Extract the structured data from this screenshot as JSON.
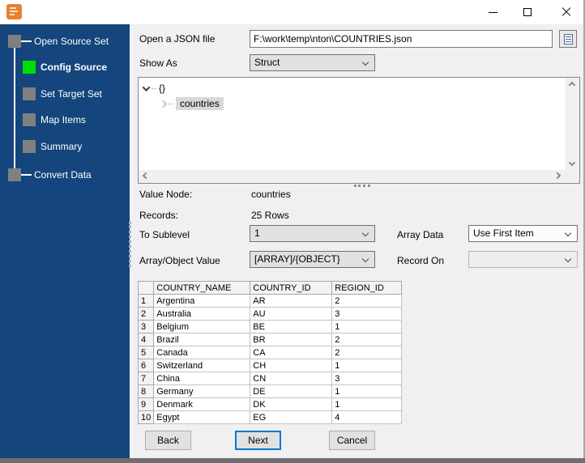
{
  "colors": {
    "sidebar_bg": "#14457C",
    "active_step_green": "#00DE00",
    "inactive_step_gray": "#808080",
    "focus_blue": "#0078D7",
    "selection_gray": "#D9D9D9"
  },
  "titlebar": {
    "icons": {
      "app": "orange-app-icon",
      "minimize": "minimize-icon",
      "maximize": "maximize-icon",
      "close": "close-icon"
    }
  },
  "sidebar": {
    "steps": [
      {
        "label": "Open Source Set"
      },
      {
        "label": "Config Source"
      },
      {
        "label": "Set Target Set"
      },
      {
        "label": "Map Items"
      },
      {
        "label": "Summary"
      },
      {
        "label": "Convert Data"
      }
    ]
  },
  "file_row": {
    "label": "Open a JSON file",
    "value": "F:\\work\\temp\\nton\\COUNTRIES.json"
  },
  "show_as": {
    "label": "Show As",
    "value": "Struct"
  },
  "tree": {
    "root_label": "{}",
    "child_label": "countries"
  },
  "info": {
    "value_node_label": "Value Node:",
    "value_node": "countries",
    "records_label": "Records:",
    "records": "25 Rows"
  },
  "options": {
    "to_sublevel": {
      "label": "To Sublevel",
      "value": "1"
    },
    "array_data": {
      "label": "Array Data",
      "value": "Use First Item"
    },
    "array_object_value": {
      "label": "Array/Object Value",
      "value": "[ARRAY]/{OBJECT}"
    },
    "record_on": {
      "label": "Record On",
      "value": ""
    }
  },
  "table": {
    "columns": [
      "COUNTRY_NAME",
      "COUNTRY_ID",
      "REGION_ID"
    ],
    "rows": [
      {
        "num": "1",
        "name": "Argentina",
        "id": "AR",
        "region": "2"
      },
      {
        "num": "2",
        "name": "Australia",
        "id": "AU",
        "region": "3"
      },
      {
        "num": "3",
        "name": "Belgium",
        "id": "BE",
        "region": "1"
      },
      {
        "num": "4",
        "name": "Brazil",
        "id": "BR",
        "region": "2"
      },
      {
        "num": "5",
        "name": "Canada",
        "id": "CA",
        "region": "2"
      },
      {
        "num": "6",
        "name": "Switzerland",
        "id": "CH",
        "region": "1"
      },
      {
        "num": "7",
        "name": "China",
        "id": "CN",
        "region": "3"
      },
      {
        "num": "8",
        "name": "Germany",
        "id": "DE",
        "region": "1"
      },
      {
        "num": "9",
        "name": "Denmark",
        "id": "DK",
        "region": "1"
      },
      {
        "num": "10",
        "name": "Egypt",
        "id": "EG",
        "region": "4"
      }
    ]
  },
  "buttons": {
    "back": "Back",
    "next": "Next",
    "cancel": "Cancel"
  }
}
